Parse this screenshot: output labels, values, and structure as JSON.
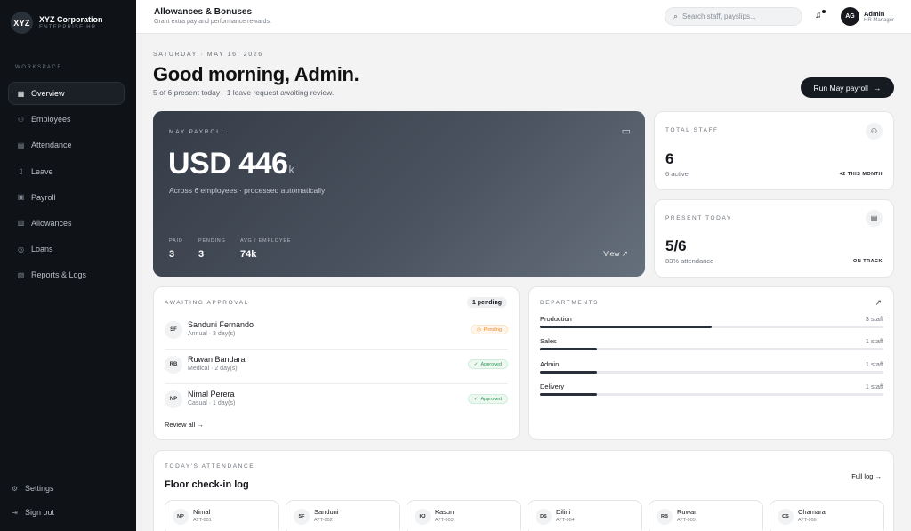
{
  "brand": {
    "logo": "XYZ",
    "name": "XYZ Corporation",
    "sub": "ENTERPRISE HR"
  },
  "sidebar": {
    "section_label": "WORKSPACE",
    "items": [
      {
        "label": "Overview",
        "icon": "grid-icon"
      },
      {
        "label": "Employees",
        "icon": "users-icon"
      },
      {
        "label": "Attendance",
        "icon": "calendar-icon"
      },
      {
        "label": "Leave",
        "icon": "document-icon"
      },
      {
        "label": "Payroll",
        "icon": "clipboard-icon"
      },
      {
        "label": "Allowances",
        "icon": "gift-icon"
      },
      {
        "label": "Loans",
        "icon": "coins-icon"
      },
      {
        "label": "Reports & Logs",
        "icon": "report-icon"
      }
    ],
    "settings": "Settings",
    "signout": "Sign out"
  },
  "topbar": {
    "title": "Allowances & Bonuses",
    "subtitle": "Grant extra pay and performance rewards.",
    "search_placeholder": "Search staff, payslips...",
    "user_initials": "AG",
    "user_name": "Admin",
    "user_role": "HR Manager"
  },
  "page": {
    "date": "SATURDAY · MAY 16, 2026",
    "greeting": "Good morning, Admin.",
    "summary": "5 of 6 present today · 1 leave request awaiting review.",
    "run_button": "Run May payroll"
  },
  "payroll": {
    "label": "MAY PAYROLL",
    "amount": "USD 446",
    "unit": "k",
    "sub": "Across 6 employees · processed automatically",
    "stats": [
      {
        "label": "PAID",
        "value": "3"
      },
      {
        "label": "PENDING",
        "value": "3"
      },
      {
        "label": "AVG / EMPLOYEE",
        "value": "74k"
      }
    ],
    "view": "View ↗"
  },
  "total_staff": {
    "label": "TOTAL STAFF",
    "value": "6",
    "sub": "6 active",
    "tag": "+2 THIS MONTH"
  },
  "present_today": {
    "label": "PRESENT TODAY",
    "value": "5/6",
    "sub": "83% attendance",
    "tag": "ON TRACK"
  },
  "approvals": {
    "label": "AWAITING APPROVAL",
    "pill": "1 pending",
    "rows": [
      {
        "initials": "SF",
        "name": "Sanduni Fernando",
        "meta": "Annual · 3 day(s)",
        "status": "Pending",
        "status_icon": "clock-icon"
      },
      {
        "initials": "RB",
        "name": "Ruwan Bandara",
        "meta": "Medical · 2 day(s)",
        "status": "Approved",
        "status_icon": "check-icon"
      },
      {
        "initials": "NP",
        "name": "Nimal Perera",
        "meta": "Casual · 1 day(s)",
        "status": "Approved",
        "status_icon": "check-icon"
      }
    ],
    "review_all": "Review all →"
  },
  "departments": {
    "label": "DEPARTMENTS",
    "rows": [
      {
        "name": "Production",
        "count": "3 staff",
        "share": 0.5
      },
      {
        "name": "Sales",
        "count": "1 staff",
        "share": 0.167
      },
      {
        "name": "Admin",
        "count": "1 staff",
        "share": 0.167
      },
      {
        "name": "Delivery",
        "count": "1 staff",
        "share": 0.167
      }
    ]
  },
  "attendance": {
    "label": "TODAY'S ATTENDANCE",
    "title": "Floor check-in log",
    "full_log": "Full log →",
    "items": [
      {
        "initials": "NP",
        "name": "Nimal",
        "id": "ATT-001"
      },
      {
        "initials": "SF",
        "name": "Sanduni",
        "id": "ATT-002"
      },
      {
        "initials": "KJ",
        "name": "Kasun",
        "id": "ATT-003"
      },
      {
        "initials": "DS",
        "name": "Dilini",
        "id": "ATT-004"
      },
      {
        "initials": "RB",
        "name": "Ruwan",
        "id": "ATT-005"
      },
      {
        "initials": "CS",
        "name": "Chamara",
        "id": "ATT-006"
      }
    ]
  }
}
